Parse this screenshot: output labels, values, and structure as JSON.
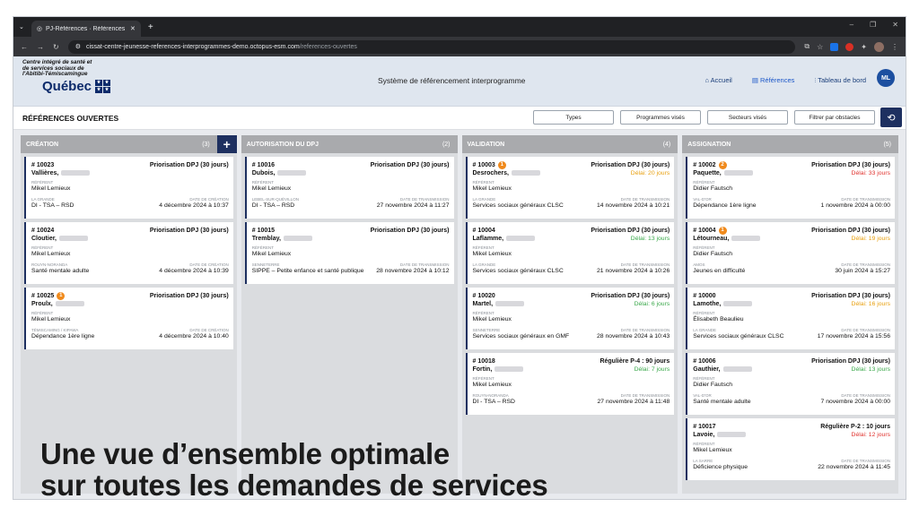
{
  "browser": {
    "tab_title": "PJ-Références · Références ouv",
    "url_host": "cissat-centre-jeunesse-references-interprogrammes-demo.octopus-esm.com",
    "url_path": "/references-ouvertes"
  },
  "header": {
    "logo_text": "Centre intégré de santé et de services sociaux de l'Abitibi-Témiscamingue",
    "logo_brand": "Québec",
    "system_title": "Système de référencement interprogramme",
    "nav": [
      {
        "label": "Accueil",
        "icon": "home-icon"
      },
      {
        "label": "Références",
        "icon": "document-icon"
      },
      {
        "label": "Tableau de bord",
        "icon": "chart-icon"
      }
    ],
    "avatar": "ML"
  },
  "toolbar": {
    "title": "RÉFÉRENCES OUVERTES",
    "filters": [
      "Types",
      "Programmes visés",
      "Secteurs visés",
      "Filtrer par obstacles"
    ]
  },
  "labels": {
    "referent": "RÉFÉRENT",
    "date_creation": "DATE DE CRÉATION",
    "date_transmission": "DATE DE TRANSMISSION"
  },
  "columns": [
    {
      "title": "CRÉATION",
      "count": "(3)",
      "date_label": "DATE DE CRÉATION",
      "cards": [
        {
          "id": "# 10023",
          "badge": "",
          "name": "Vallières,",
          "type": "Priorisation DPJ (30 jours)",
          "delay": "",
          "delay_color": "",
          "referent": "Mikel Lemieux",
          "sector": "LA GRANDE",
          "program": "DI - TSA – RSD",
          "date": "4 décembre 2024 à 10:37"
        },
        {
          "id": "# 10024",
          "badge": "",
          "name": "Cloutier,",
          "type": "Priorisation DPJ (30 jours)",
          "delay": "",
          "delay_color": "",
          "referent": "Mikel Lemieux",
          "sector": "ROUYN-NORANDA",
          "program": "Santé mentale adulte",
          "date": "4 décembre 2024 à 10:39"
        },
        {
          "id": "# 10025",
          "badge": "1",
          "name": "Proulx,",
          "type": "Priorisation DPJ (30 jours)",
          "delay": "",
          "delay_color": "",
          "referent": "Mikel Lemieux",
          "sector": "TÉMISCAMING / KIPAWA",
          "program": "Dépendance 1ère ligne",
          "date": "4 décembre 2024 à 10:40"
        }
      ]
    },
    {
      "title": "AUTORISATION DU DPJ",
      "count": "(2)",
      "date_label": "DATE DE TRANSMISSION",
      "cards": [
        {
          "id": "# 10016",
          "badge": "",
          "name": "Dubois,",
          "type": "Priorisation DPJ (30 jours)",
          "delay": "",
          "delay_color": "",
          "referent": "Mikel Lemieux",
          "sector": "LEBEL-SUR-QUÉVILLON",
          "program": "DI - TSA – RSD",
          "date": "27 novembre 2024 à 11:27"
        },
        {
          "id": "# 10015",
          "badge": "",
          "name": "Tremblay,",
          "type": "Priorisation DPJ (30 jours)",
          "delay": "",
          "delay_color": "",
          "referent": "Mikel Lemieux",
          "sector": "SENNETERRE",
          "program": "SIPPE – Petite enfance et santé publique",
          "date": "28 novembre 2024 à 10:12"
        }
      ]
    },
    {
      "title": "VALIDATION",
      "count": "(4)",
      "date_label": "DATE DE TRANSMISSION",
      "cards": [
        {
          "id": "# 10003",
          "badge": "1",
          "name": "Desrochers,",
          "type": "Priorisation DPJ (30 jours)",
          "delay": "Délai: 20 jours",
          "delay_color": "#e8a010",
          "referent": "Mikel Lemieux",
          "sector": "LA GRANDE",
          "program": "Services sociaux généraux CLSC",
          "date": "14 novembre 2024 à 10:21"
        },
        {
          "id": "# 10004",
          "badge": "",
          "name": "Laflamme,",
          "type": "Priorisation DPJ (30 jours)",
          "delay": "Délai: 13 jours",
          "delay_color": "#3aa84a",
          "referent": "Mikel Lemieux",
          "sector": "LA GRANDE",
          "program": "Services sociaux généraux CLSC",
          "date": "21 novembre 2024 à 10:26"
        },
        {
          "id": "# 10020",
          "badge": "",
          "name": "Martel,",
          "type": "Priorisation DPJ (30 jours)",
          "delay": "Délai: 6 jours",
          "delay_color": "#3aa84a",
          "referent": "Mikel Lemieux",
          "sector": "SENNETERRE",
          "program": "Services sociaux généraux en GMF",
          "date": "28 novembre 2024 à 10:43"
        },
        {
          "id": "# 10018",
          "badge": "",
          "name": "Fortin,",
          "type": "Régulière P-4 : 90 jours",
          "delay": "Délai: 7 jours",
          "delay_color": "#3aa84a",
          "referent": "Mikel Lemieux",
          "sector": "ROUYN-NORANDA",
          "program": "DI - TSA – RSD",
          "date": "27 novembre 2024 à 11:48"
        }
      ]
    },
    {
      "title": "ASSIGNATION",
      "count": "(5)",
      "date_label": "DATE DE TRANSMISSION",
      "cards": [
        {
          "id": "# 10002",
          "badge": "2",
          "name": "Paquette,",
          "type": "Priorisation DPJ (30 jours)",
          "delay": "Délai: 33 jours",
          "delay_color": "#e0322e",
          "referent": "Didier Fautsch",
          "sector": "VAL-D'OR",
          "program": "Dépendance 1ère ligne",
          "date": "1 novembre 2024 à 00:00"
        },
        {
          "id": "# 10004",
          "badge": "1",
          "name": "Létourneau,",
          "type": "Priorisation DPJ (30 jours)",
          "delay": "Délai: 19 jours",
          "delay_color": "#e8a010",
          "referent": "Didier Fautsch",
          "sector": "AMOS",
          "program": "Jeunes en difficulté",
          "date": "30 juin 2024 à 15:27"
        },
        {
          "id": "# 10000",
          "badge": "",
          "name": "Lamothe,",
          "type": "Priorisation DPJ (30 jours)",
          "delay": "Délai: 16 jours",
          "delay_color": "#e8a010",
          "referent": "Élisabeth Beaulieu",
          "sector": "LA GRANDE",
          "program": "Services sociaux généraux CLSC",
          "date": "17 novembre 2024 à 15:56"
        },
        {
          "id": "# 10006",
          "badge": "",
          "name": "Gauthier,",
          "type": "Priorisation DPJ (30 jours)",
          "delay": "Délai: 13 jours",
          "delay_color": "#3aa84a",
          "referent": "Didier Fautsch",
          "sector": "VAL-D'OR",
          "program": "Santé mentale adulte",
          "date": "7 novembre 2024 à 00:00"
        },
        {
          "id": "# 10017",
          "badge": "",
          "name": "Lavoie,",
          "type": "Régulière P-2 : 10 jours",
          "delay": "Délai: 12 jours",
          "delay_color": "#e0322e",
          "referent": "Mikel Lemieux",
          "sector": "LA SARRE",
          "program": "Déficience physique",
          "date": "22 novembre 2024 à 11:45"
        }
      ]
    }
  ],
  "overlay": {
    "line1": "Une vue d’ensemble optimale",
    "line2": "sur toutes les demandes de services"
  }
}
